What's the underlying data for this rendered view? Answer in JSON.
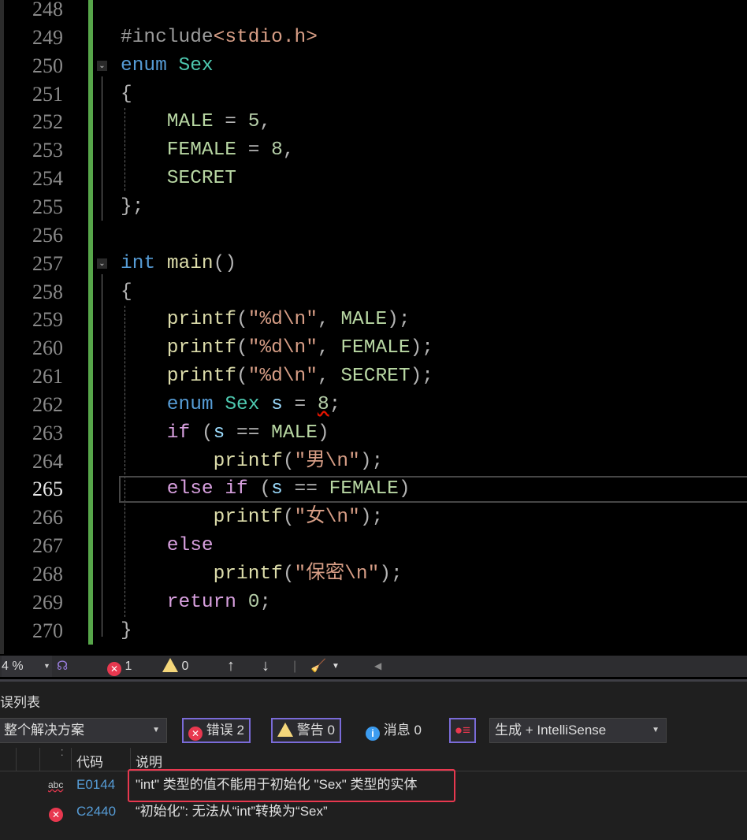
{
  "editor": {
    "current_line": 265,
    "lines": [
      {
        "n": 248,
        "tokens": []
      },
      {
        "n": 249,
        "indent": 0,
        "tokens": [
          [
            "pp",
            "#include"
          ],
          [
            "str",
            "<stdio.h>"
          ]
        ]
      },
      {
        "n": 250,
        "indent": 0,
        "fold": true,
        "tokens": [
          [
            "kw",
            "enum"
          ],
          [
            "p",
            " "
          ],
          [
            "type",
            "Sex"
          ]
        ]
      },
      {
        "n": 251,
        "indent": 0,
        "tokens": [
          [
            "p",
            "{"
          ]
        ]
      },
      {
        "n": 252,
        "indent": 1,
        "tokens": [
          [
            "enum",
            "MALE"
          ],
          [
            "p",
            " = "
          ],
          [
            "num",
            "5"
          ],
          [
            "p",
            ","
          ]
        ]
      },
      {
        "n": 253,
        "indent": 1,
        "tokens": [
          [
            "enum",
            "FEMALE"
          ],
          [
            "p",
            " = "
          ],
          [
            "num",
            "8"
          ],
          [
            "p",
            ","
          ]
        ]
      },
      {
        "n": 254,
        "indent": 1,
        "tokens": [
          [
            "enum",
            "SECRET"
          ]
        ]
      },
      {
        "n": 255,
        "indent": 0,
        "tokens": [
          [
            "p",
            "};"
          ]
        ]
      },
      {
        "n": 256,
        "tokens": []
      },
      {
        "n": 257,
        "indent": 0,
        "fold": true,
        "tokens": [
          [
            "kw",
            "int"
          ],
          [
            "p",
            " "
          ],
          [
            "fn",
            "main"
          ],
          [
            "p",
            "()"
          ]
        ]
      },
      {
        "n": 258,
        "indent": 0,
        "tokens": [
          [
            "p",
            "{"
          ]
        ]
      },
      {
        "n": 259,
        "indent": 1,
        "tokens": [
          [
            "fn",
            "printf"
          ],
          [
            "p",
            "("
          ],
          [
            "str",
            "\"%d\\n\""
          ],
          [
            "p",
            ", "
          ],
          [
            "enum",
            "MALE"
          ],
          [
            "p",
            ");"
          ]
        ]
      },
      {
        "n": 260,
        "indent": 1,
        "tokens": [
          [
            "fn",
            "printf"
          ],
          [
            "p",
            "("
          ],
          [
            "str",
            "\"%d\\n\""
          ],
          [
            "p",
            ", "
          ],
          [
            "enum",
            "FEMALE"
          ],
          [
            "p",
            ");"
          ]
        ]
      },
      {
        "n": 261,
        "indent": 1,
        "tokens": [
          [
            "fn",
            "printf"
          ],
          [
            "p",
            "("
          ],
          [
            "str",
            "\"%d\\n\""
          ],
          [
            "p",
            ", "
          ],
          [
            "enum",
            "SECRET"
          ],
          [
            "p",
            ");"
          ]
        ]
      },
      {
        "n": 262,
        "indent": 1,
        "tokens": [
          [
            "kw",
            "enum"
          ],
          [
            "p",
            " "
          ],
          [
            "type",
            "Sex"
          ],
          [
            "p",
            " "
          ],
          [
            "var",
            "s"
          ],
          [
            "p",
            " = "
          ],
          [
            "num squig",
            "8"
          ],
          [
            "p",
            ";"
          ]
        ]
      },
      {
        "n": 263,
        "indent": 1,
        "tokens": [
          [
            "ctl",
            "if"
          ],
          [
            "p",
            " ("
          ],
          [
            "var",
            "s"
          ],
          [
            "p",
            " == "
          ],
          [
            "enum",
            "MALE"
          ],
          [
            "p",
            ")"
          ]
        ]
      },
      {
        "n": 264,
        "indent": 2,
        "tokens": [
          [
            "fn",
            "printf"
          ],
          [
            "p",
            "("
          ],
          [
            "str",
            "\"男\\n\""
          ],
          [
            "p",
            ");"
          ]
        ]
      },
      {
        "n": 265,
        "indent": 1,
        "tokens": [
          [
            "ctl",
            "else"
          ],
          [
            "p",
            " "
          ],
          [
            "ctl",
            "if"
          ],
          [
            "p",
            " ("
          ],
          [
            "var",
            "s"
          ],
          [
            "p",
            " == "
          ],
          [
            "enum",
            "FEMALE"
          ],
          [
            "p",
            ")"
          ]
        ]
      },
      {
        "n": 266,
        "indent": 2,
        "tokens": [
          [
            "fn",
            "printf"
          ],
          [
            "p",
            "("
          ],
          [
            "str",
            "\"女\\n\""
          ],
          [
            "p",
            ");"
          ]
        ]
      },
      {
        "n": 267,
        "indent": 1,
        "tokens": [
          [
            "ctl",
            "else"
          ]
        ]
      },
      {
        "n": 268,
        "indent": 2,
        "tokens": [
          [
            "fn",
            "printf"
          ],
          [
            "p",
            "("
          ],
          [
            "str",
            "\"保密\\n\""
          ],
          [
            "p",
            ");"
          ]
        ]
      },
      {
        "n": 269,
        "indent": 1,
        "tokens": [
          [
            "ctl",
            "return"
          ],
          [
            "p",
            " "
          ],
          [
            "num",
            "0"
          ],
          [
            "p",
            ";"
          ]
        ]
      },
      {
        "n": 270,
        "indent": 0,
        "tokens": [
          [
            "p",
            "}"
          ]
        ]
      }
    ]
  },
  "status": {
    "zoom": "4 %",
    "errors": "1",
    "warnings": "0"
  },
  "error_list": {
    "title": "误列表",
    "scope": "整个解决方案",
    "errors_label": "错误 2",
    "warnings_label": "警告 0",
    "messages_label": "消息 0",
    "source": "生成 + IntelliSense",
    "columns": {
      "code": "代码",
      "description": "说明"
    },
    "rows": [
      {
        "icon": "spell-abc",
        "code": "E0144",
        "description": "\"int\" 类型的值不能用于初始化 \"Sex\" 类型的实体",
        "highlighted": true
      },
      {
        "icon": "error",
        "code": "C2440",
        "description": "“初始化”: 无法从“int”转换为“Sex”"
      }
    ],
    "highlight_color": "#e8384f"
  }
}
